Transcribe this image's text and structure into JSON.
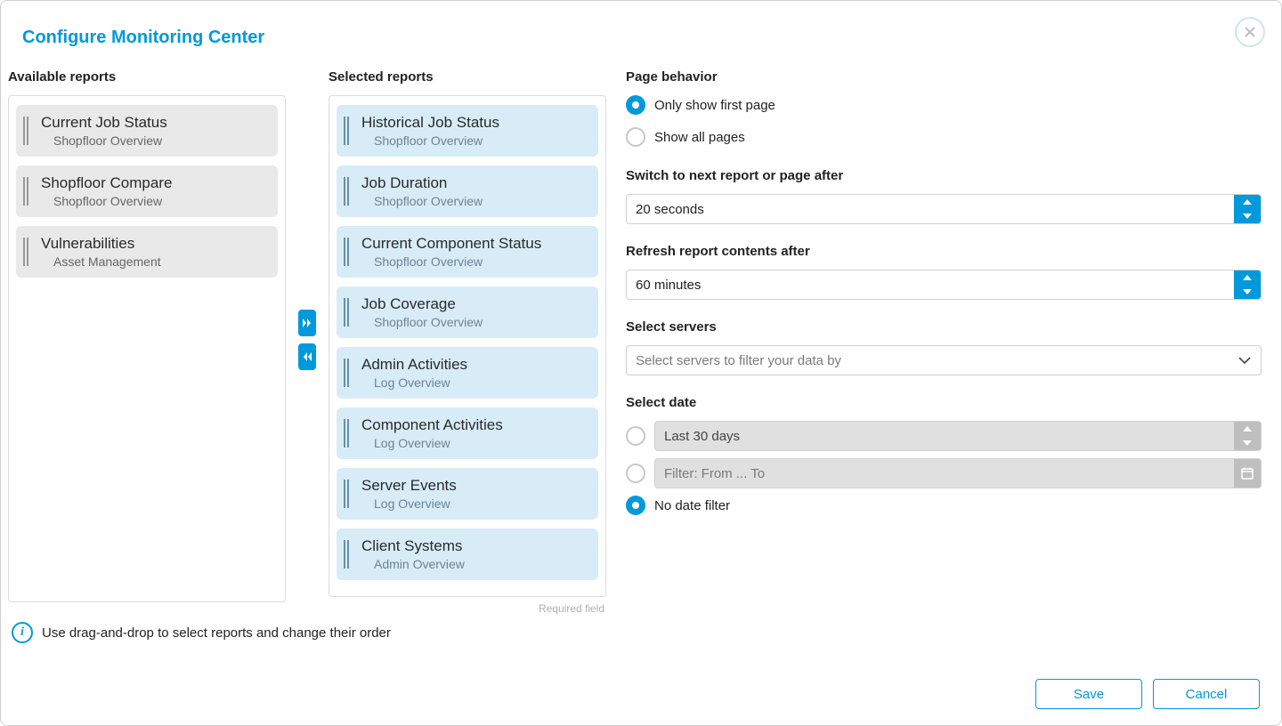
{
  "title": "Configure Monitoring Center",
  "available": {
    "header": "Available reports",
    "items": [
      {
        "title": "Current Job Status",
        "sub": "Shopfloor Overview"
      },
      {
        "title": "Shopfloor Compare",
        "sub": "Shopfloor Overview"
      },
      {
        "title": "Vulnerabilities",
        "sub": "Asset Management"
      }
    ]
  },
  "selected": {
    "header": "Selected reports",
    "items": [
      {
        "title": "Historical Job Status",
        "sub": "Shopfloor Overview"
      },
      {
        "title": "Job Duration",
        "sub": "Shopfloor Overview"
      },
      {
        "title": "Current Component Status",
        "sub": "Shopfloor Overview"
      },
      {
        "title": "Job Coverage",
        "sub": "Shopfloor Overview"
      },
      {
        "title": "Admin Activities",
        "sub": "Log Overview"
      },
      {
        "title": "Component Activities",
        "sub": "Log Overview"
      },
      {
        "title": "Server Events",
        "sub": "Log Overview"
      },
      {
        "title": "Client Systems",
        "sub": "Admin Overview"
      }
    ],
    "required_label": "Required field"
  },
  "settings": {
    "page_behavior": {
      "header": "Page behavior",
      "opt_first": "Only show first page",
      "opt_all": "Show all pages"
    },
    "switch_next": {
      "label": "Switch to next report or page after",
      "value": "20 seconds"
    },
    "refresh": {
      "label": "Refresh report contents after",
      "value": "60 minutes"
    },
    "servers": {
      "label": "Select servers",
      "placeholder": "Select servers to filter your data by"
    },
    "date": {
      "label": "Select date",
      "preset_value": "Last 30 days",
      "range_placeholder": "Filter:  From ... To",
      "nofilter": "No date filter"
    }
  },
  "hint": "Use drag-and-drop to select reports and change their order",
  "buttons": {
    "save": "Save",
    "cancel": "Cancel"
  }
}
